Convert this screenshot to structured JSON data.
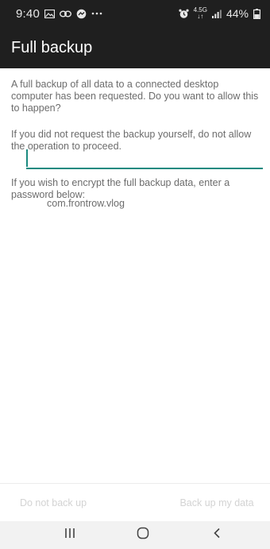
{
  "status_bar": {
    "time": "9:40",
    "data_label_top": "4.5G",
    "data_label_bottom": "↓↑",
    "battery": "44%"
  },
  "app_bar": {
    "title": "Full backup"
  },
  "content": {
    "intro_text": "A full backup of all data to a connected desktop computer has been requested. Do you want to allow this to happen?",
    "warning_text": "If you did not request the backup yourself, do not allow the operation to proceed.",
    "encrypt_text": "If you wish to encrypt the full backup data, enter a password below:",
    "password_value": "",
    "package_name": "com.frontrow.vlog"
  },
  "buttons": {
    "deny_label": "Do not back up",
    "allow_label": "Back up my data"
  },
  "colors": {
    "bar_background": "#1f1f1f",
    "accent": "#1a8a80",
    "body_text": "#6c6c6c",
    "disabled_text": "#d3d3d3"
  },
  "icons": {
    "status_left": [
      "image-icon",
      "link-icon",
      "messenger-icon",
      "more-dots-icon"
    ],
    "status_right": [
      "alarm-icon",
      "signal-icon",
      "battery-icon"
    ],
    "nav": [
      "recents-icon",
      "home-icon",
      "back-icon"
    ]
  }
}
